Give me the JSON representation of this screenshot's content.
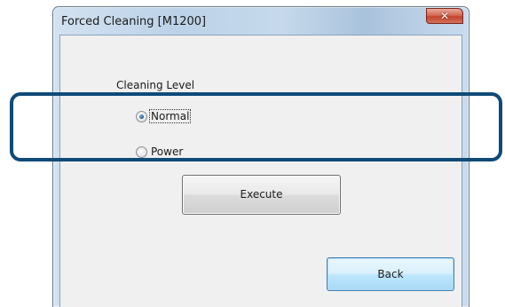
{
  "window": {
    "title": "Forced Cleaning [M1200]",
    "close_glyph": "✕"
  },
  "cleaning_level": {
    "label": "Cleaning Level",
    "options": [
      {
        "label": "Normal",
        "selected": true
      },
      {
        "label": "Power",
        "selected": false
      }
    ]
  },
  "buttons": {
    "execute": "Execute",
    "back": "Back"
  },
  "colors": {
    "callout_border": "#0f4a78",
    "default_button_border": "#3c7fb1"
  },
  "icons": {
    "close": "close-icon"
  }
}
